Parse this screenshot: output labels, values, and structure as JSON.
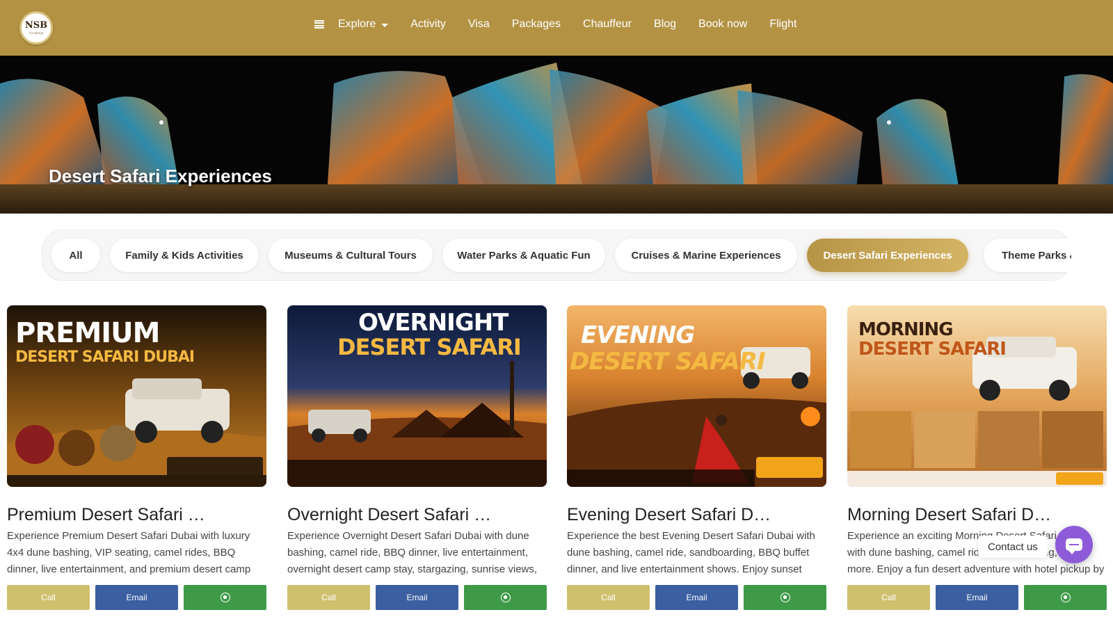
{
  "header": {
    "logo_text": "NSB",
    "logo_sub": "TOURISM",
    "nav": [
      "Explore",
      "Activity",
      "Visa",
      "Packages",
      "Chauffeur",
      "Blog",
      "Book now",
      "Flight"
    ]
  },
  "hero": {
    "title": "Desert Safari Experiences"
  },
  "filters": {
    "items": [
      "All",
      "Family & Kids Activities",
      "Museums & Cultural Tours",
      "Water Parks & Aquatic Fun",
      "Cruises & Marine Experiences",
      "Desert Safari Experiences",
      "Theme Parks &"
    ],
    "active": "Desert Safari Experiences"
  },
  "cards": [
    {
      "title": "Premium Desert Safari D…",
      "description": "Experience Premium Desert Safari Dubai with luxury 4x4 dune bashing, VIP seating, camel rides, BBQ dinner, live entertainment, and premium desert camp",
      "image_headline": "PREMIUM",
      "image_subline": "DESERT SAFARI DUBAI",
      "call_label": "Call",
      "email_label": "Email"
    },
    {
      "title": "Overnight Desert Safari …",
      "description": "Experience Overnight Desert Safari Dubai with dune bashing, camel ride, BBQ dinner, live entertainment, overnight desert camp stay, stargazing, sunrise views,",
      "image_headline": "OVERNIGHT",
      "image_subline": "DESERT SAFARI",
      "call_label": "Call",
      "email_label": "Email"
    },
    {
      "title": "Evening Desert Safari D…",
      "description": "Experience the best Evening Desert Safari Dubai with dune bashing, camel ride, sandboarding, BBQ buffet dinner, and live entertainment shows. Enjoy sunset",
      "image_headline": "EVENING",
      "image_subline": "DESERT SAFARI",
      "call_label": "Call",
      "email_label": "Email"
    },
    {
      "title": "Morning Desert Safari D…",
      "description": "Experience an exciting Morning Desert Safari Dubai with dune bashing, camel ride, sandboarding, and more. Enjoy a fun desert adventure with hotel pickup by NSB",
      "image_headline": "MORNING",
      "image_subline": "DESERT SAFARI",
      "call_label": "Call",
      "email_label": "Email"
    }
  ],
  "contact": {
    "label": "Contact us"
  },
  "colors": {
    "header": "#b39343",
    "call": "#cfc06e",
    "email": "#3b5fa0",
    "whatsapp": "#3f9a48",
    "contact": "#8e5bd8"
  }
}
